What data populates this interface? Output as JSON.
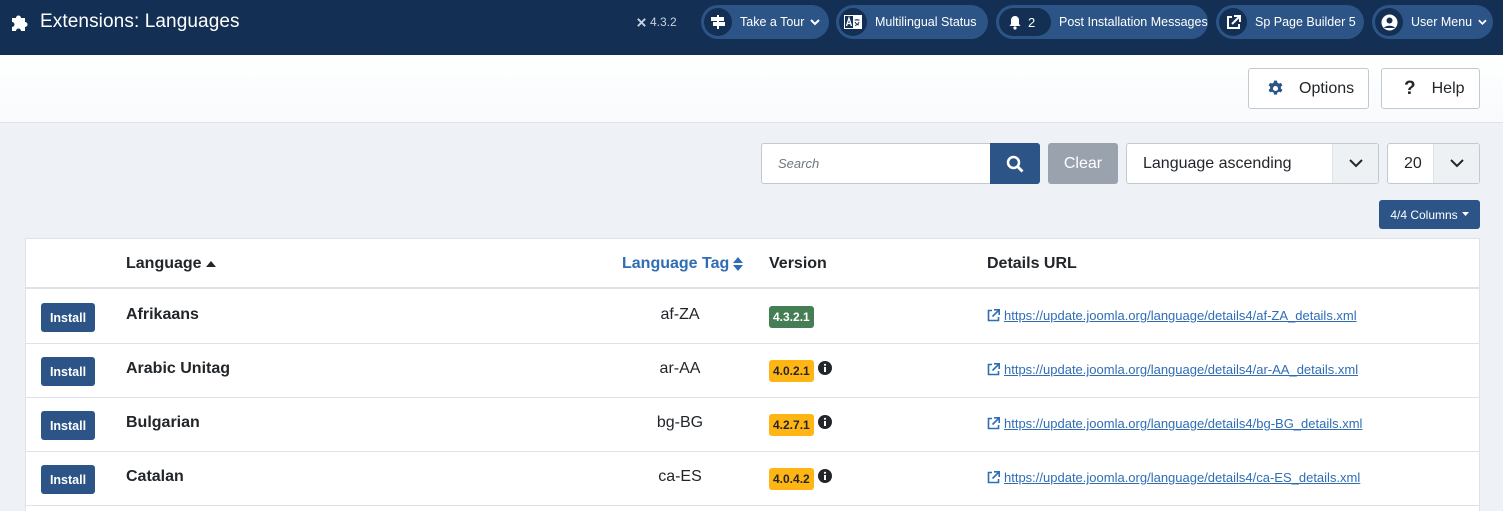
{
  "header": {
    "title": "Extensions: Languages",
    "version": "4.3.2",
    "take_tour": "Take a Tour",
    "multilingual": "Multilingual Status",
    "post_install_count": "2",
    "post_install": "Post Installation Messages",
    "sp_page_builder": "Sp Page Builder 5",
    "user_menu": "User Menu"
  },
  "toolbar": {
    "options": "Options",
    "help": "Help"
  },
  "filters": {
    "search_placeholder": "Search",
    "clear": "Clear",
    "ordering": "Language ascending",
    "limit": "20",
    "columns": "4/4 Columns"
  },
  "table": {
    "headers": {
      "language": "Language",
      "tag": "Language Tag",
      "version": "Version",
      "details": "Details URL"
    },
    "install_label": "Install",
    "rows": [
      {
        "language": "Afrikaans",
        "tag": "af-ZA",
        "version": "4.3.2.1",
        "status": "current",
        "url": "https://update.joomla.org/language/details4/af-ZA_details.xml"
      },
      {
        "language": "Arabic Unitag",
        "tag": "ar-AA",
        "version": "4.0.2.1",
        "status": "outdated",
        "url": "https://update.joomla.org/language/details4/ar-AA_details.xml"
      },
      {
        "language": "Bulgarian",
        "tag": "bg-BG",
        "version": "4.2.7.1",
        "status": "outdated",
        "url": "https://update.joomla.org/language/details4/bg-BG_details.xml"
      },
      {
        "language": "Catalan",
        "tag": "ca-ES",
        "version": "4.0.4.2",
        "status": "outdated",
        "url": "https://update.joomla.org/language/details4/ca-ES_details.xml"
      }
    ]
  },
  "colors": {
    "header_bg": "#132f53",
    "pill_bg": "#2c5486",
    "primary": "#2c5486",
    "badge_current": "#457d54",
    "badge_outdated": "#ffb514",
    "link": "#2f6db5"
  },
  "icons": [
    "puzzle-icon",
    "joomla-icon",
    "signpost-icon",
    "translate-icon",
    "bell-icon",
    "external-link-icon",
    "user-icon",
    "gear-icon",
    "question-icon",
    "search-icon",
    "chevron-down-icon",
    "sort-up-icon",
    "sort-icon",
    "info-icon"
  ]
}
